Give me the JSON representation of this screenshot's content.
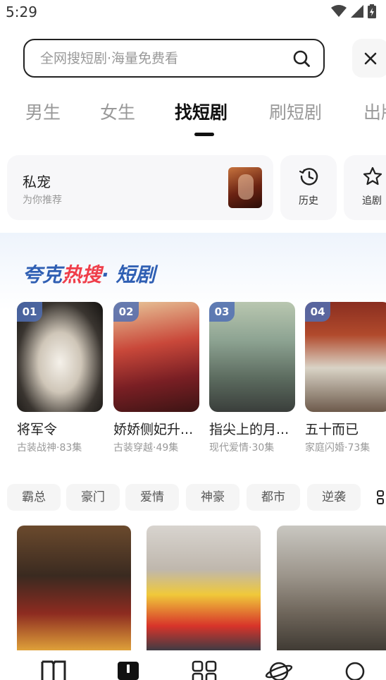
{
  "status": {
    "time": "5:29"
  },
  "search": {
    "placeholder": "全网搜短剧·海量免费看"
  },
  "tabs": [
    {
      "label": "男生"
    },
    {
      "label": "女生"
    },
    {
      "label": "找短剧"
    },
    {
      "label": "刷短剧"
    },
    {
      "label": "出版"
    }
  ],
  "feature": {
    "title": "私宠",
    "subtitle": "为你推荐"
  },
  "quick_actions": [
    {
      "label": "历史",
      "icon": "history-clock-icon"
    },
    {
      "label": "追剧",
      "icon": "star-icon"
    }
  ],
  "hot": {
    "part1": "夸克",
    "part2": "热搜",
    "part3": "· 短剧"
  },
  "dramas": [
    {
      "rank": "01",
      "name": "将军令",
      "meta": "古装战神·83集"
    },
    {
      "rank": "02",
      "name": "娇娇侧妃升...",
      "meta": "古装穿越·49集"
    },
    {
      "rank": "03",
      "name": "指尖上的月...",
      "meta": "现代爱情·30集"
    },
    {
      "rank": "04",
      "name": "五十而已",
      "meta": "家庭闪婚·73集"
    }
  ],
  "categories": [
    {
      "label": "霸总"
    },
    {
      "label": "豪门"
    },
    {
      "label": "爱情"
    },
    {
      "label": "神豪"
    },
    {
      "label": "都市"
    },
    {
      "label": "逆袭"
    }
  ],
  "colors": {
    "accent_blue": "#2f5fb3",
    "accent_red": "#ef3e4a"
  }
}
